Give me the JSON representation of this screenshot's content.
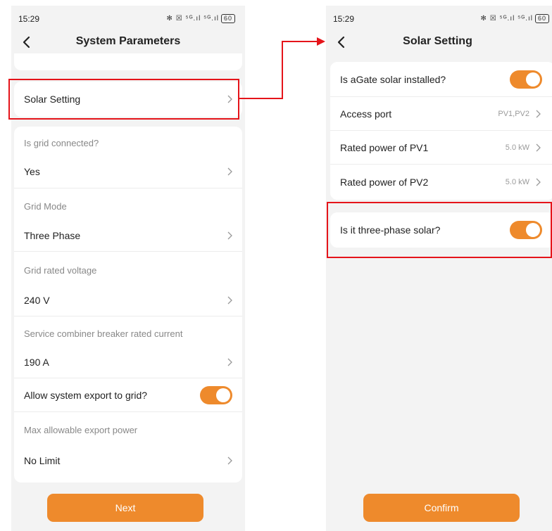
{
  "left_screen": {
    "status_time": "15:29",
    "status_icons": "✻ ☒ ⁵ᴳ.ıl ⁵ᴳ.ıl",
    "battery": "60",
    "title": "System Parameters",
    "solar_setting_label": "Solar Setting",
    "items": [
      {
        "sub": "Is grid connected?",
        "value": "Yes"
      },
      {
        "sub": "Grid Mode",
        "value": "Three Phase"
      },
      {
        "sub": "Grid rated voltage",
        "value": "240 V"
      },
      {
        "sub": "Service combiner breaker rated current",
        "value": "190 A"
      }
    ],
    "export_label": "Allow system export to grid?",
    "export_enabled": true,
    "max_export_sub": "Max allowable export power",
    "max_export_value": "No Limit",
    "next_button": "Next"
  },
  "right_screen": {
    "status_time": "15:29",
    "status_icons": "✻ ☒ ⁵ᴳ.ıl ⁵ᴳ.ıl",
    "battery": "60",
    "title": "Solar Setting",
    "solar_installed_label": "Is aGate solar installed?",
    "solar_installed_enabled": true,
    "access_port_label": "Access port",
    "access_port_value": "PV1,PV2",
    "pv1_label": "Rated power of PV1",
    "pv1_value": "5.0 kW",
    "pv2_label": "Rated power of PV2",
    "pv2_value": "5.0 kW",
    "three_phase_label": "Is it three-phase solar?",
    "three_phase_enabled": true,
    "confirm_button": "Confirm"
  },
  "colors": {
    "accent": "#ee8a2c",
    "highlight": "#e5141a",
    "background": "#f3f3f3"
  }
}
